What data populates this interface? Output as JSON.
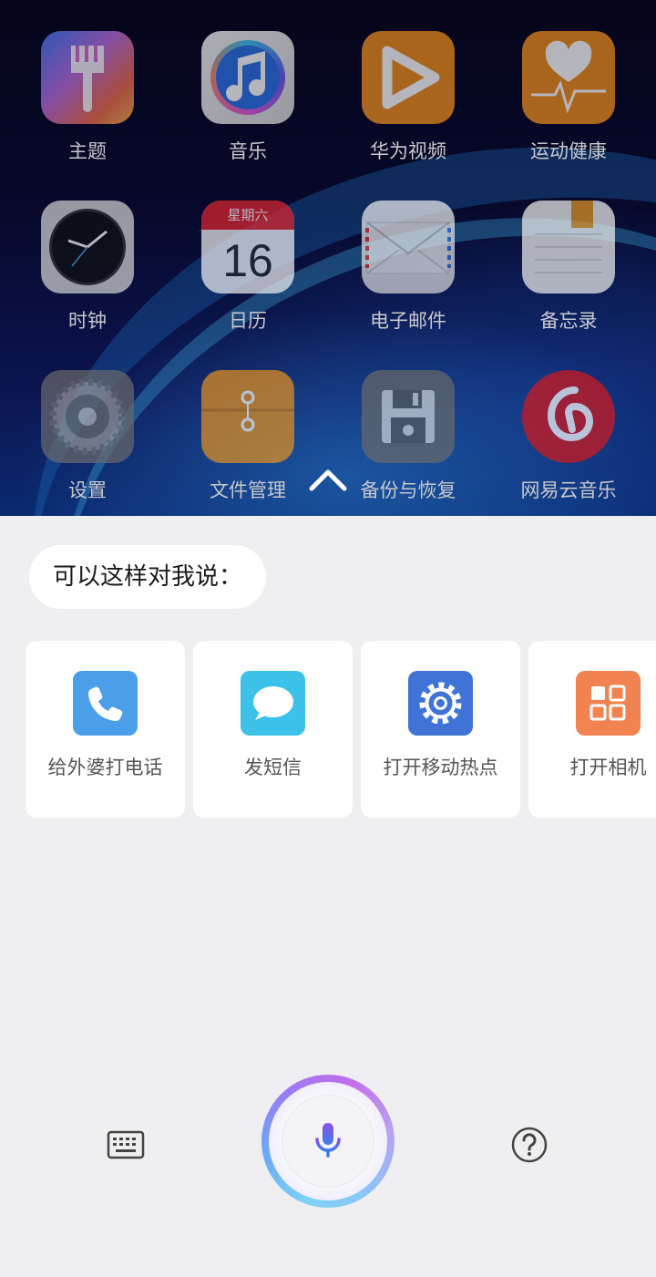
{
  "home_screen": {
    "apps": [
      {
        "label": "主题",
        "icon": "theme-brush-icon"
      },
      {
        "label": "音乐",
        "icon": "music-note-icon"
      },
      {
        "label": "华为视频",
        "icon": "video-play-icon"
      },
      {
        "label": "运动健康",
        "icon": "heart-pulse-icon"
      },
      {
        "label": "时钟",
        "icon": "clock-icon"
      },
      {
        "label": "日历",
        "icon": "calendar-icon",
        "calendar_weekday": "星期六",
        "calendar_day": "16"
      },
      {
        "label": "电子邮件",
        "icon": "mail-envelope-icon"
      },
      {
        "label": "备忘录",
        "icon": "memo-notepad-icon"
      },
      {
        "label": "设置",
        "icon": "gear-icon"
      },
      {
        "label": "文件管理",
        "icon": "folder-icon"
      },
      {
        "label": "备份与恢复",
        "icon": "floppy-disk-icon"
      },
      {
        "label": "网易云音乐",
        "icon": "netease-music-icon"
      }
    ],
    "swipe_up_icon": "chevron-up-icon"
  },
  "assistant": {
    "prompt": "可以这样对我说：",
    "suggestions": [
      {
        "label": "给外婆打电话",
        "icon": "phone-icon",
        "color": "#4a9fe8"
      },
      {
        "label": "发短信",
        "icon": "message-bubble-icon",
        "color": "#3cc2e8"
      },
      {
        "label": "打开移动热点",
        "icon": "hotspot-gear-icon",
        "color": "#3f74d6"
      },
      {
        "label": "打开相机",
        "icon": "apps-grid-icon",
        "color": "#f0834f"
      }
    ],
    "bottom_bar": {
      "keyboard_icon": "keyboard-icon",
      "mic_icon": "microphone-icon",
      "help_icon": "question-mark-icon"
    }
  }
}
